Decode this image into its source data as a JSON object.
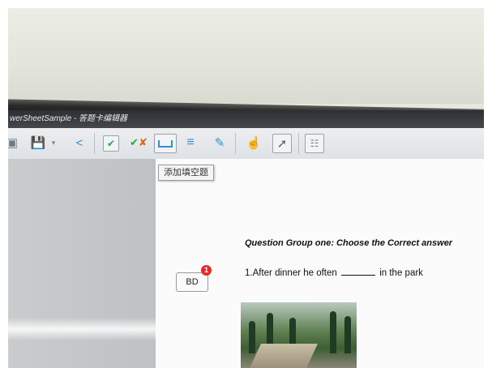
{
  "window": {
    "title": "werSheetSample - 答题卡编辑器"
  },
  "toolbar": {
    "tooltip": "添加填空题",
    "icons": [
      "folder-icon",
      "save-icon",
      "dropdown-icon",
      "share-icon",
      "check-box-icon",
      "check-cross-icon",
      "fill-blank-icon",
      "lines-icon",
      "pen-icon",
      "hand-icon",
      "pointer-icon",
      "template-icon"
    ]
  },
  "document": {
    "heading": "Question Group one: Choose the Correct answer",
    "question": {
      "prefix": "1.After dinner he often",
      "suffix": "in the park"
    },
    "answer_box": {
      "label": "BD",
      "badge": "1"
    }
  },
  "colors": {
    "badge": "#e32b2b",
    "titlebar": "#2d2f33"
  }
}
